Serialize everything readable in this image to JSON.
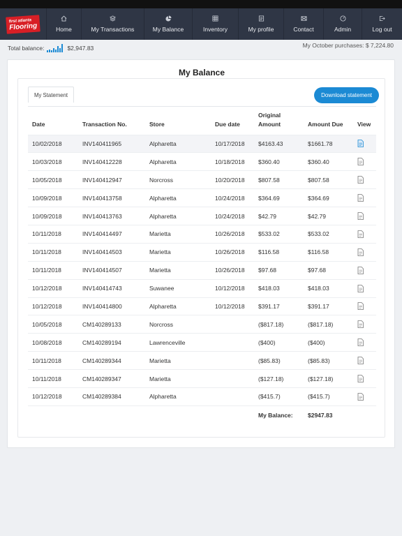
{
  "brand": {
    "logo_line1": "first atlanta",
    "logo_line2": "Flooring"
  },
  "nav": [
    {
      "label": "Home",
      "icon": "home-icon"
    },
    {
      "label": "My Transactions",
      "icon": "layers-icon"
    },
    {
      "label": "My Balance",
      "icon": "pie-chart-icon"
    },
    {
      "label": "Inventory",
      "icon": "grid-icon"
    },
    {
      "label": "My profile",
      "icon": "profile-card-icon"
    },
    {
      "label": "Contact",
      "icon": "envelope-icon"
    },
    {
      "label": "Admin",
      "icon": "gauge-icon"
    },
    {
      "label": "Log out",
      "icon": "logout-icon"
    }
  ],
  "summary": {
    "total_balance_label": "Total balance:",
    "total_balance_value": "$2,947.83",
    "month_purchases": "My October purchases: $ 7,224.80"
  },
  "page": {
    "title": "My Balance",
    "tab_label": "My Statement",
    "download_label": "Download statement"
  },
  "table": {
    "headers": {
      "date": "Date",
      "txn": "Transaction No.",
      "store": "Store",
      "due": "Due date",
      "orig1": "Original",
      "orig2": "Amount",
      "amount_due": "Amount Due",
      "view": "View"
    },
    "rows": [
      {
        "date": "10/02/2018",
        "txn": "INV140411965",
        "store": "Alpharetta",
        "due": "10/17/2018",
        "orig": "$4163.43",
        "amount_due": "$1661.78"
      },
      {
        "date": "10/03/2018",
        "txn": "INV140412228",
        "store": "Alpharetta",
        "due": "10/18/2018",
        "orig": "$360.40",
        "amount_due": "$360.40"
      },
      {
        "date": "10/05/2018",
        "txn": "INV140412947",
        "store": "Norcross",
        "due": "10/20/2018",
        "orig": "$807.58",
        "amount_due": "$807.58"
      },
      {
        "date": "10/09/2018",
        "txn": "INV140413758",
        "store": "Alpharetta",
        "due": "10/24/2018",
        "orig": "$364.69",
        "amount_due": "$364.69"
      },
      {
        "date": "10/09/2018",
        "txn": "INV140413763",
        "store": "Alpharetta",
        "due": "10/24/2018",
        "orig": "$42.79",
        "amount_due": "$42.79"
      },
      {
        "date": "10/11/2018",
        "txn": "INV140414497",
        "store": "Marietta",
        "due": "10/26/2018",
        "orig": "$533.02",
        "amount_due": "$533.02"
      },
      {
        "date": "10/11/2018",
        "txn": "INV140414503",
        "store": "Marietta",
        "due": "10/26/2018",
        "orig": "$116.58",
        "amount_due": "$116.58"
      },
      {
        "date": "10/11/2018",
        "txn": "INV140414507",
        "store": "Marietta",
        "due": "10/26/2018",
        "orig": "$97.68",
        "amount_due": "$97.68"
      },
      {
        "date": "10/12/2018",
        "txn": "INV140414743",
        "store": "Suwanee",
        "due": "10/12/2018",
        "orig": "$418.03",
        "amount_due": "$418.03"
      },
      {
        "date": "10/12/2018",
        "txn": "INV140414800",
        "store": "Alpharetta",
        "due": "10/12/2018",
        "orig": "$391.17",
        "amount_due": "$391.17"
      },
      {
        "date": "10/05/2018",
        "txn": "CM140289133",
        "store": "Norcross",
        "due": "",
        "orig": "($817.18)",
        "amount_due": "($817.18)"
      },
      {
        "date": "10/08/2018",
        "txn": "CM140289194",
        "store": "Lawrenceville",
        "due": "",
        "orig": "($400)",
        "amount_due": "($400)"
      },
      {
        "date": "10/11/2018",
        "txn": "CM140289344",
        "store": "Marietta",
        "due": "",
        "orig": "($85.83)",
        "amount_due": "($85.83)"
      },
      {
        "date": "10/11/2018",
        "txn": "CM140289347",
        "store": "Marietta",
        "due": "",
        "orig": "($127.18)",
        "amount_due": "($127.18)"
      },
      {
        "date": "10/12/2018",
        "txn": "CM140289384",
        "store": "Alpharetta",
        "due": "",
        "orig": "($415.7)",
        "amount_due": "($415.7)"
      }
    ],
    "total_label": "My Balance:",
    "total_value": "$2947.83"
  },
  "colors": {
    "nav_bg": "#2f3645",
    "accent": "#1b8ad4",
    "brand_red": "#d81f26"
  }
}
